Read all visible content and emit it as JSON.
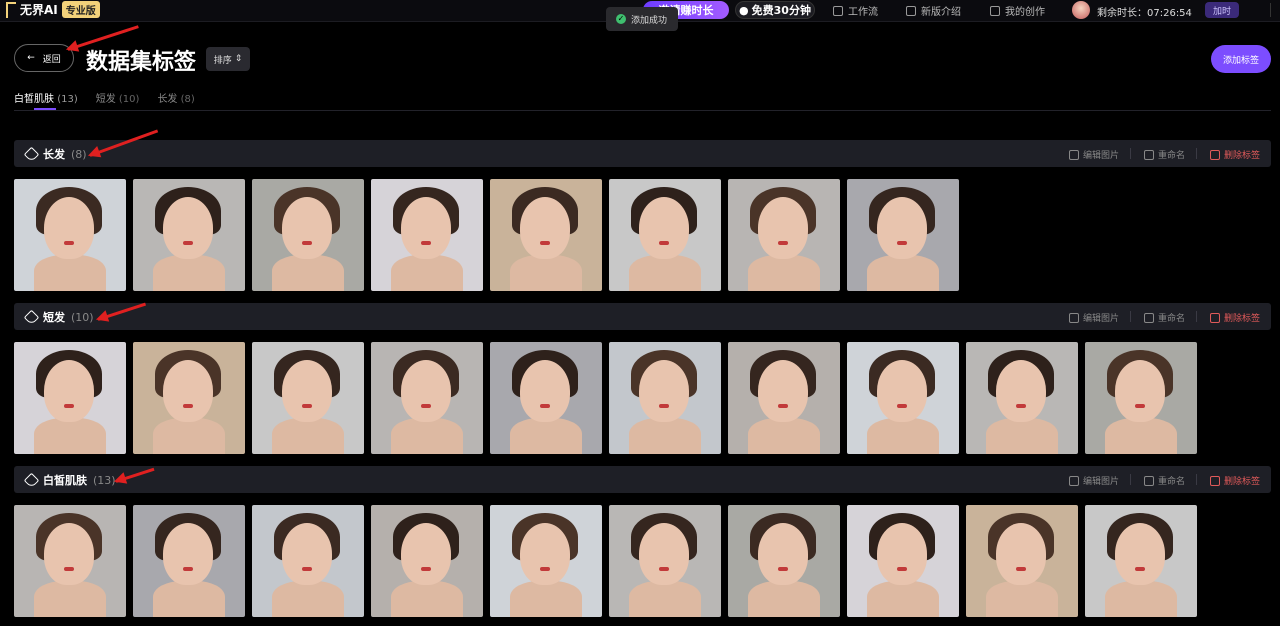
{
  "topbar": {
    "logo_text": "无界AI",
    "pro_badge": "专业版",
    "invite_label": "邀请赚时长",
    "free_label": "免费30分钟",
    "nav": [
      {
        "label": "工作流",
        "icon": "workflow-icon"
      },
      {
        "label": "新版介绍",
        "icon": "new-icon"
      },
      {
        "label": "我的创作",
        "icon": "image-icon"
      }
    ],
    "remaining_label": "剩余时长：07:26:54",
    "add_time_label": "加时"
  },
  "toast": {
    "text": "添加成功",
    "icon": "check-circle-icon"
  },
  "header": {
    "back_label": "返回",
    "title": "数据集标签",
    "sort_label": "排序",
    "add_tag_label": "添加标签"
  },
  "tabs": [
    {
      "label": "白皙肌肤",
      "count": "(13)",
      "active": true
    },
    {
      "label": "短发",
      "count": "(10)",
      "active": false
    },
    {
      "label": "长发",
      "count": "(8)",
      "active": false
    }
  ],
  "actions": {
    "edit": "编辑图片",
    "rename": "重命名",
    "delete": "删除标签"
  },
  "sections": [
    {
      "title": "长发",
      "count": "(8)",
      "image_count_visible": 8
    },
    {
      "title": "短发",
      "count": "(10)",
      "image_count_visible": 10
    },
    {
      "title": "白皙肌肤",
      "count": "(13)",
      "image_count_visible": 10
    }
  ],
  "colors": {
    "accent": "#7c4dff",
    "danger": "#e05a5a",
    "section_bg": "#1e1f26",
    "annotation": "#e02020"
  }
}
